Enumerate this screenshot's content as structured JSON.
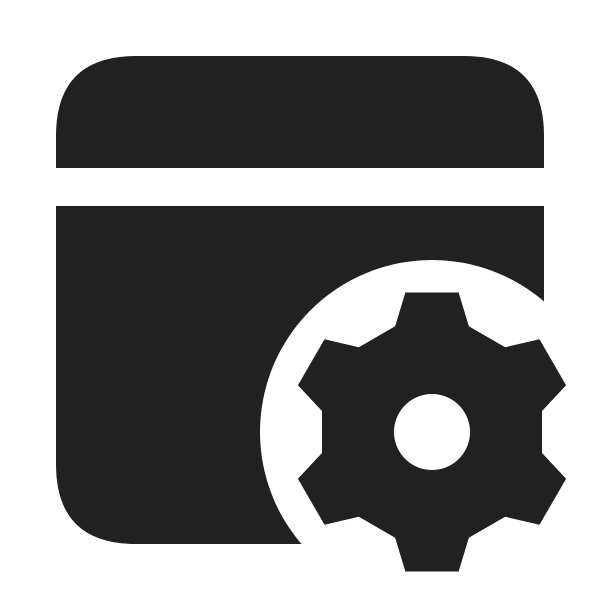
{
  "icon": {
    "name": "window-settings-icon",
    "parts": [
      "browser-window-icon",
      "gear-icon"
    ],
    "colors": {
      "foreground": "#212121",
      "background": "#ffffff"
    }
  }
}
